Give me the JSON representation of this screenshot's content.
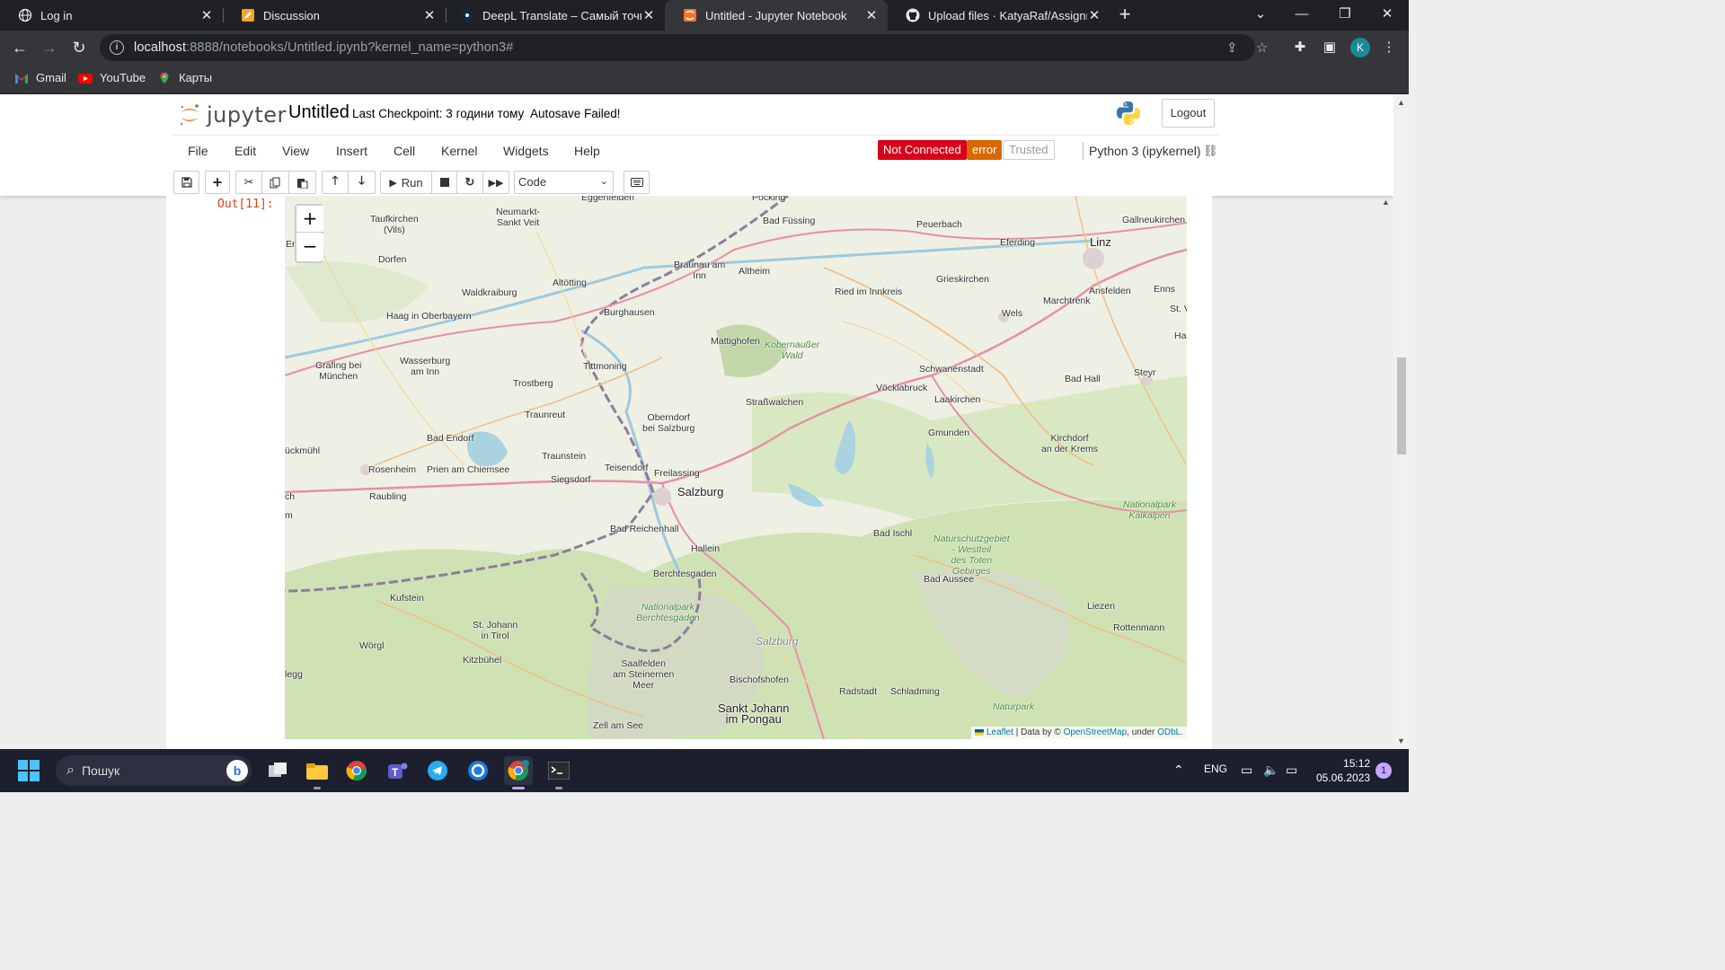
{
  "browser": {
    "tabs": [
      {
        "title": "Log in",
        "icon": "globe-icon",
        "active": false
      },
      {
        "title": "Discussion",
        "icon": "pencil-icon",
        "active": false
      },
      {
        "title": "DeepL Translate – Самый точный",
        "icon": "deepl-icon",
        "active": false
      },
      {
        "title": "Untitled - Jupyter Notebook",
        "icon": "jupyter-icon",
        "active": true
      },
      {
        "title": "Upload files · KatyaRaf/Assignme",
        "icon": "github-icon",
        "active": false
      }
    ],
    "url_host": "localhost",
    "url_rest": ":8888/notebooks/Untitled.ipynb?kernel_name=python3#",
    "profile_initial": "K",
    "bookmarks": [
      {
        "label": "Gmail",
        "icon": "gmail-icon"
      },
      {
        "label": "YouTube",
        "icon": "youtube-icon"
      },
      {
        "label": "Карты",
        "icon": "maps-icon"
      }
    ]
  },
  "jupyter": {
    "logo_text": "jupyter",
    "notebook_name": "Untitled",
    "checkpoint": "Last Checkpoint: 3 години тому",
    "autosave": "Autosave Failed!",
    "logout_label": "Logout",
    "menu": [
      "File",
      "Edit",
      "View",
      "Insert",
      "Cell",
      "Kernel",
      "Widgets",
      "Help"
    ],
    "status_not_connected": "Not Connected",
    "status_error": "error",
    "status_trusted": "Trusted",
    "kernel_name": "Python 3 (ipykernel)",
    "run_label": "Run",
    "cell_type": "Code",
    "colors": {
      "not_connected": "#d9001b",
      "error": "#d86800",
      "prompt": "#d84315"
    }
  },
  "output": {
    "prompt": "Out[11]:",
    "zoom_in": "+",
    "zoom_out": "−",
    "attribution": {
      "leaflet": "Leaflet",
      "data_by": " | Data by © ",
      "osm": "OpenStreetMap",
      "under": ", under ",
      "odbl": "ODbL."
    },
    "map_labels": [
      "Eggenfelden",
      "Pocking",
      "Bad Füssing",
      "Taufkirchen\n(Vils)",
      "Neumarkt-\nSankt Veit",
      "Peuerbach",
      "Gallneukirchen",
      "Erd",
      "Eferding",
      "Linz",
      "Dorfen",
      "Braunau am\nInn",
      "Altheim",
      "Altötting",
      "Waldkraiburg",
      "Ried im Innkreis",
      "Grieskirchen",
      "Ansfelden",
      "Enns",
      "Marchtrenk",
      "Haag in Oberbayern",
      "Burghausen",
      "Wels",
      "St. Valent",
      "Mattighofen",
      "Kobernaußer\nWald",
      "Haa",
      "Grafing bei\nMünchen",
      "Wasserburg\nam Inn",
      "Tittmoning",
      "Schwanenstadt",
      "Steyr",
      "Bad Hall",
      "Trostberg",
      "Vöcklabruck",
      "Straßwalchen",
      "Laakirchen",
      "Traunreut",
      "Oberndorf\nbei Salzburg",
      "Gmunden",
      "Kirchdorf\nan der Krems",
      "Bad Endorf",
      "ückmühl",
      "Traunstein",
      "Rosenheim",
      "Prien am Chiemsee",
      "Teisendorf",
      "Freilassing",
      "Siegsdorf",
      "Salzburg",
      "ch",
      "Raubling",
      "Nationalpark\nKalkalpen",
      "m",
      "Bad Reichenhall",
      "Bad Ischl",
      "Naturschutzgebiet\n- Westteil\ndes Toten\nGebirges",
      "Hallein",
      "Berchtesgaden",
      "Bad Aussee",
      "Kufstein",
      "Nationalpark\nBerchtesgaden",
      "Liezen",
      "St. Johann\nin Tirol",
      "Rottenmann",
      "Wörgl",
      "Salzburg",
      "Kitzbühel",
      "Saalfelden\nam Steinernen\nMeer",
      "legg",
      "Bischofshofen",
      "Radstadt",
      "Schladming",
      "Naturpark",
      "Sankt Johann\nim Pongau",
      "Zell am See"
    ]
  },
  "taskbar": {
    "search_placeholder": "Пошук",
    "language": "ENG",
    "time": "15:12",
    "date": "05.06.2023",
    "notifications": "1"
  }
}
